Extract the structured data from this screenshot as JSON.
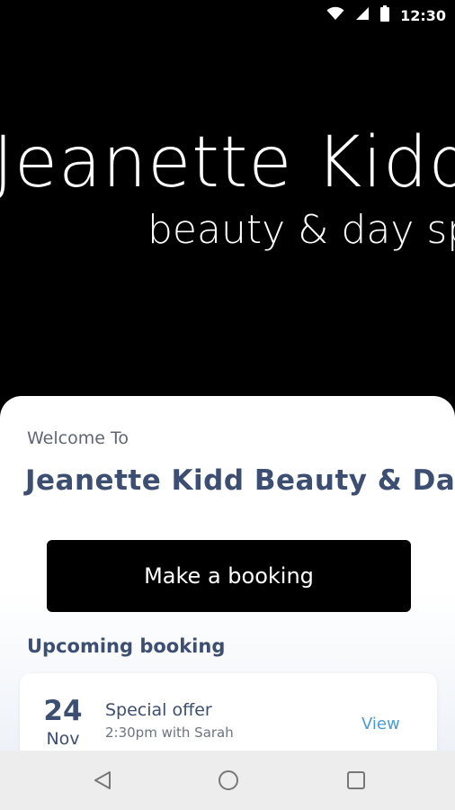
{
  "status_bar": {
    "time": "12:30",
    "icons": [
      "wifi-icon",
      "cellular-signal-icon",
      "battery-icon"
    ]
  },
  "hero": {
    "title": "Jeanette Kidd",
    "subtitle": "beauty & day spa"
  },
  "welcome": {
    "label": "Welcome To",
    "venue_name": "Jeanette Kidd Beauty & Day Spa"
  },
  "booking_button": {
    "label": "Make a booking"
  },
  "upcoming": {
    "section_title": "Upcoming booking",
    "booking": {
      "day": "24",
      "month": "Nov",
      "name": "Special offer",
      "detail": "2:30pm with Sarah",
      "action": "View"
    }
  },
  "nav_bar": {
    "icons": [
      "back-icon",
      "home-icon",
      "recents-icon"
    ]
  },
  "colors": {
    "brand_navy": "#3c4e72",
    "link_blue": "#4a9cd6",
    "button_bg": "#000000"
  }
}
